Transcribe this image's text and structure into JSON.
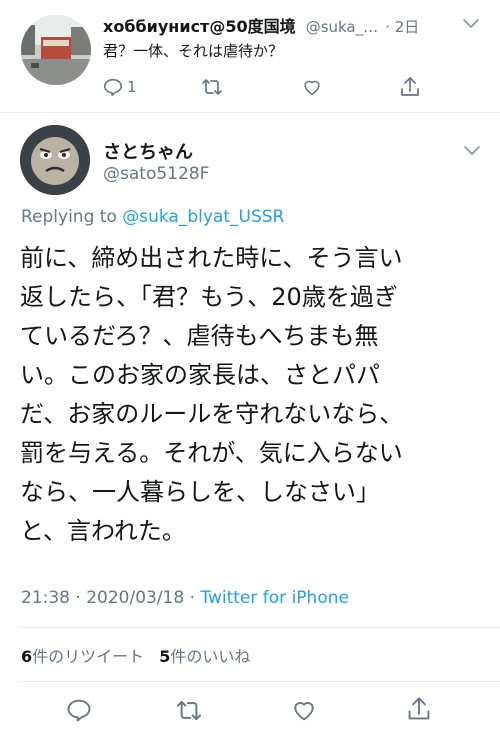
{
  "parent": {
    "display_name": "хоббиунист@50度国境",
    "handle": "@suka_…",
    "age": "· 2日",
    "text": "君？一体、それは虐待か？",
    "reply_count": "1"
  },
  "tweet": {
    "display_name": "さとちゃん",
    "handle": "@sato5128F",
    "replying_prefix": "Replying to",
    "replying_to": "@suka_blyat_USSR",
    "lines": [
      "前に、締め出された時に、そう言い",
      "返したら、「君？もう、20歳を過ぎ",
      "ているだろ？、虐待もへちまも無",
      "い。このお家の家長は、さとパパ",
      "だ、お家のルールを守れないなら、",
      "罰を与える。それが、気に入らない",
      "なら、一人暮らしを、しなさい」",
      "と、言われた。"
    ],
    "timestamp": "21:38 · 2020/03/18 ·",
    "source": "Twitter for iPhone",
    "retweet_count": "6",
    "retweet_label": "件のリツイート",
    "like_count": "5",
    "like_label": "件のいいね"
  },
  "colors": {
    "accent": "#1da1f2",
    "muted": "#657786",
    "text": "#14171a",
    "divider": "#e6ecf0"
  }
}
